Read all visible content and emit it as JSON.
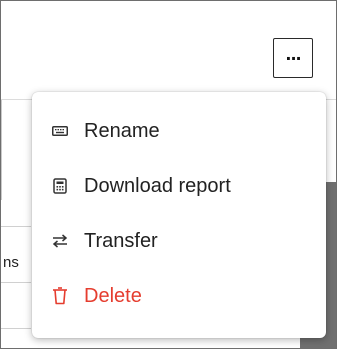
{
  "toolbar": {
    "more_label": "..."
  },
  "table": {
    "partial_cell": "ns"
  },
  "menu": {
    "items": [
      {
        "label": "Rename",
        "icon": "keyboard-icon"
      },
      {
        "label": "Download report",
        "icon": "calculator-icon"
      },
      {
        "label": "Transfer",
        "icon": "transfer-arrows-icon"
      },
      {
        "label": "Delete",
        "icon": "trash-icon",
        "color": "#e53d2f"
      }
    ]
  },
  "colors": {
    "danger": "#e53d2f",
    "backdrop": "#6e6e6e"
  }
}
